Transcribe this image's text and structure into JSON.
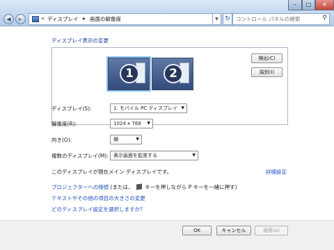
{
  "address_bar": {
    "chevrons": "«",
    "crumb_1": "ディスプレイ",
    "separator": "▸",
    "crumb_2": "画面の解像度"
  },
  "search": {
    "placeholder": "コントロール パネルの検索"
  },
  "window_controls": {
    "minimize": "–",
    "maximize": "□",
    "close": "✕"
  },
  "page": {
    "title": "ディスプレイ表示の変更"
  },
  "preview": {
    "monitors": [
      {
        "number": "1"
      },
      {
        "number": "2"
      }
    ],
    "detect_label": "検出(C)",
    "identify_label": "識別(I)"
  },
  "form": {
    "display_label": "ディスプレイ(S):",
    "display_value": "1. モバイル PC ディスプレイ",
    "resolution_label": "解像度(R):",
    "resolution_value": "1024 x 768",
    "orientation_label": "向き(O):",
    "orientation_value": "横",
    "multiple_label": "複数のディスプレイ(M):",
    "multiple_value": "表示画面を拡張する"
  },
  "main_display_text": "このディスプレイが現在メイン ディスプレイです。",
  "advanced_link": "詳細設定",
  "links": {
    "projector_link": "プロジェクターへの接続",
    "projector_note_pre": "(または、",
    "projector_note_post": "キーを押しながら P キーを一緒に押す)",
    "text_size_link": "テキストやその他の項目の大きさの変更",
    "which_settings_link": "どのディスプレイ設定を選択しますか?"
  },
  "buttons": {
    "ok": "OK",
    "cancel": "キャンセル",
    "apply": "適用(A)"
  },
  "icons": {
    "back": "back-arrow-icon",
    "forward": "forward-arrow-icon",
    "refresh": "refresh-icon",
    "search": "search-icon",
    "control_panel": "control-panel-icon",
    "windows_key": "windows-key-icon"
  },
  "colors": {
    "link": "#1e4fbe",
    "title_bar": "#c4d8ef",
    "close_button": "#c2463a",
    "monitor": "#334b7a"
  }
}
